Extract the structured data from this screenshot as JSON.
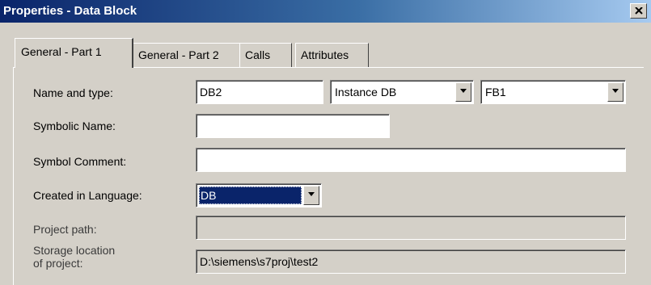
{
  "window": {
    "title": "Properties - Data Block",
    "close_icon": "close-icon"
  },
  "tabs": [
    {
      "label": "General - Part 1",
      "active": true
    },
    {
      "label": "General - Part 2",
      "active": false
    },
    {
      "label": "Calls",
      "active": false
    },
    {
      "label": "Attributes",
      "active": false
    }
  ],
  "form": {
    "name_and_type": {
      "label": "Name and type:",
      "name_value": "DB2",
      "type_value": "Instance DB",
      "fb_value": "FB1"
    },
    "symbolic_name": {
      "label": "Symbolic Name:",
      "value": ""
    },
    "symbol_comment": {
      "label": "Symbol Comment:",
      "value": ""
    },
    "created_in_language": {
      "label": "Created in Language:",
      "value": "DB"
    },
    "project_path": {
      "label": "Project path:",
      "value": ""
    },
    "storage_location": {
      "label_line1": "Storage location",
      "label_line2": "of project:",
      "value": "D:\\siemens\\s7proj\\test2"
    }
  },
  "colors": {
    "dialog_bg": "#d4d0c8",
    "title_bar_start": "#0a246a",
    "title_bar_end": "#a6caf0",
    "selection": "#0a246a"
  }
}
